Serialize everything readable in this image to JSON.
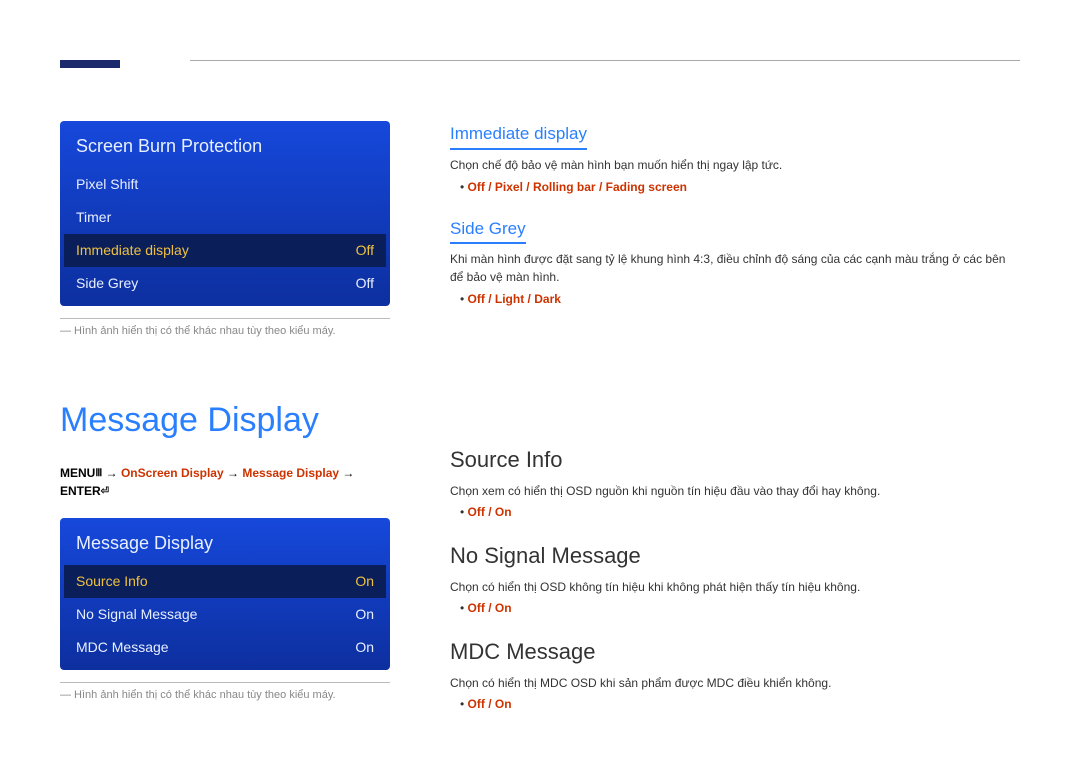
{
  "osd1": {
    "title": "Screen Burn Protection",
    "rows": [
      {
        "label": "Pixel Shift",
        "value": ""
      },
      {
        "label": "Timer",
        "value": ""
      },
      {
        "label": "Immediate display",
        "value": "Off",
        "highlight": true
      },
      {
        "label": "Side Grey",
        "value": "Off"
      }
    ]
  },
  "footnote": "― Hình ảnh hiển thị có thể khác nhau tùy theo kiểu máy.",
  "section_top": {
    "immediate": {
      "heading": "Immediate display",
      "desc": "Chọn chế độ bảo vệ màn hình bạn muốn hiển thị ngay lập tức.",
      "opts": [
        "Off",
        "Pixel",
        "Rolling bar",
        "Fading screen"
      ]
    },
    "sidegrey": {
      "heading": "Side Grey",
      "desc": "Khi màn hình được đặt sang tỷ lệ khung hình 4:3, điều chỉnh độ sáng của các cạnh màu trắng ở các bên để bảo vệ màn hình.",
      "opts": [
        "Off",
        "Light",
        "Dark"
      ]
    }
  },
  "main_heading": "Message Display",
  "menu_path": {
    "p1": "MENU",
    "p2": "OnScreen Display",
    "p3": "Message Display",
    "p4": "ENTER"
  },
  "osd2": {
    "title": "Message Display",
    "rows": [
      {
        "label": "Source Info",
        "value": "On",
        "highlight": true
      },
      {
        "label": "No Signal Message",
        "value": "On"
      },
      {
        "label": "MDC Message",
        "value": "On"
      }
    ]
  },
  "right_sections": {
    "source": {
      "heading": "Source Info",
      "desc": "Chọn xem có hiển thị OSD nguồn khi nguồn tín hiệu đầu vào thay đổi hay không.",
      "opts": [
        "Off",
        "On"
      ]
    },
    "nosignal": {
      "heading": "No Signal Message",
      "desc": "Chọn có hiển thị OSD không tín hiệu khi không phát hiện thấy tín hiệu không.",
      "opts": [
        "Off",
        "On"
      ]
    },
    "mdc": {
      "heading": "MDC Message",
      "desc": "Chọn có hiển thị MDC OSD khi sản phẩm được MDC điều khiển không.",
      "opts": [
        "Off",
        "On"
      ]
    }
  }
}
